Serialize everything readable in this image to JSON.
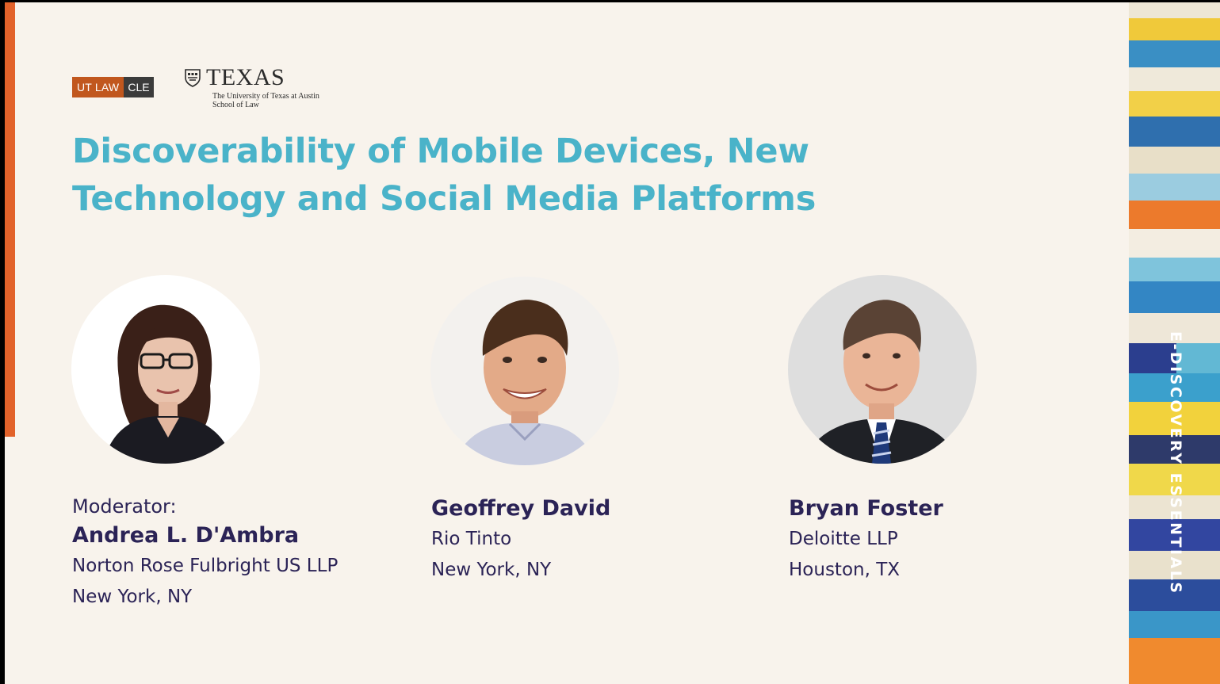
{
  "logos": {
    "utlaw_part1": "UT LAW",
    "utlaw_part2": "CLE",
    "texas_wordmark": "TEXAS",
    "texas_sub1": "The University of Texas at Austin",
    "texas_sub2": "School of Law"
  },
  "title_line1": "Discoverability of Mobile Devices, New",
  "title_line2": "Technology and Social Media Platforms",
  "speakers": [
    {
      "role": "Moderator:",
      "name": "Andrea L. D'Ambra",
      "org": "Norton Rose Fulbright US LLP",
      "location": "New York, NY"
    },
    {
      "name": "Geoffrey David",
      "org": "Rio Tinto",
      "location": "New York, NY"
    },
    {
      "name": "Bryan Foster",
      "org": "Deloitte LLP",
      "location": "Houston, TX"
    }
  ],
  "series_label": "E-DISCOVERY ESSENTIALS",
  "colors": {
    "title": "#4ab3c9",
    "text": "#2b2356",
    "accent": "#e2622a",
    "background": "#f8f3ec"
  }
}
